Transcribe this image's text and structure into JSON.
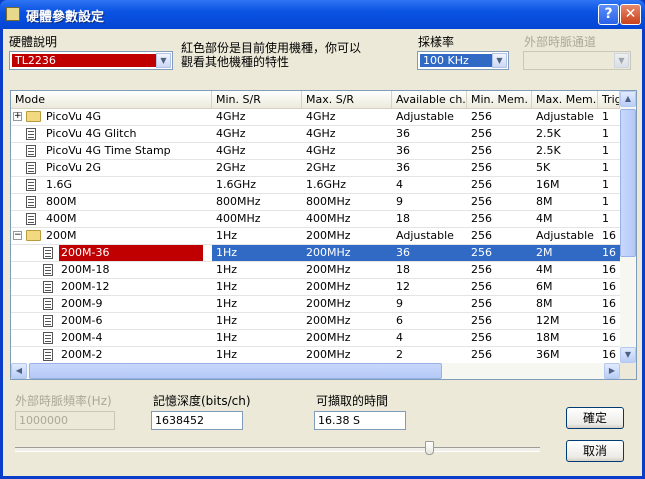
{
  "window": {
    "title": "硬體參數設定",
    "help_label": "?",
    "close_label": "✕"
  },
  "hardware": {
    "label": "硬體說明",
    "value": "TL2236",
    "hint_line1": "紅色部份是目前使用機種，你可以",
    "hint_line2": "觀看其他機種的特性"
  },
  "sample_rate": {
    "label": "採樣率",
    "value": "100 KHz"
  },
  "ext_clock_channel": {
    "label": "外部時脈通道",
    "value": ""
  },
  "table": {
    "columns": [
      "Mode",
      "Min. S/R",
      "Max. S/R",
      "Available ch.",
      "Min. Mem.",
      "Max. Mem.",
      "Trig"
    ],
    "rows": [
      {
        "mode": "PicoVu 4G",
        "min_sr": "4GHz",
        "max_sr": "4GHz",
        "avail": "Adjustable",
        "min_mem": "256",
        "max_mem": "Adjustable",
        "trig": "1"
      },
      {
        "mode": "PicoVu 4G Glitch",
        "min_sr": "4GHz",
        "max_sr": "4GHz",
        "avail": "36",
        "min_mem": "256",
        "max_mem": "2.5K",
        "trig": "1"
      },
      {
        "mode": "PicoVu 4G Time Stamp",
        "min_sr": "4GHz",
        "max_sr": "4GHz",
        "avail": "36",
        "min_mem": "256",
        "max_mem": "2.5K",
        "trig": "1"
      },
      {
        "mode": "PicoVu 2G",
        "min_sr": "2GHz",
        "max_sr": "2GHz",
        "avail": "36",
        "min_mem": "256",
        "max_mem": "5K",
        "trig": "1"
      },
      {
        "mode": "1.6G",
        "min_sr": "1.6GHz",
        "max_sr": "1.6GHz",
        "avail": "4",
        "min_mem": "256",
        "max_mem": "16M",
        "trig": "1"
      },
      {
        "mode": "800M",
        "min_sr": "800MHz",
        "max_sr": "800MHz",
        "avail": "9",
        "min_mem": "256",
        "max_mem": "8M",
        "trig": "1"
      },
      {
        "mode": "400M",
        "min_sr": "400MHz",
        "max_sr": "400MHz",
        "avail": "18",
        "min_mem": "256",
        "max_mem": "4M",
        "trig": "1"
      },
      {
        "mode": "200M",
        "min_sr": "1Hz",
        "max_sr": "200MHz",
        "avail": "Adjustable",
        "min_mem": "256",
        "max_mem": "Adjustable",
        "trig": "16"
      },
      {
        "mode": "200M-36",
        "min_sr": "1Hz",
        "max_sr": "200MHz",
        "avail": "36",
        "min_mem": "256",
        "max_mem": "2M",
        "trig": "16"
      },
      {
        "mode": "200M-18",
        "min_sr": "1Hz",
        "max_sr": "200MHz",
        "avail": "18",
        "min_mem": "256",
        "max_mem": "4M",
        "trig": "16"
      },
      {
        "mode": "200M-12",
        "min_sr": "1Hz",
        "max_sr": "200MHz",
        "avail": "12",
        "min_mem": "256",
        "max_mem": "6M",
        "trig": "16"
      },
      {
        "mode": "200M-9",
        "min_sr": "1Hz",
        "max_sr": "200MHz",
        "avail": "9",
        "min_mem": "256",
        "max_mem": "8M",
        "trig": "16"
      },
      {
        "mode": "200M-6",
        "min_sr": "1Hz",
        "max_sr": "200MHz",
        "avail": "6",
        "min_mem": "256",
        "max_mem": "12M",
        "trig": "16"
      },
      {
        "mode": "200M-4",
        "min_sr": "1Hz",
        "max_sr": "200MHz",
        "avail": "4",
        "min_mem": "256",
        "max_mem": "18M",
        "trig": "16"
      },
      {
        "mode": "200M-2",
        "min_sr": "1Hz",
        "max_sr": "200MHz",
        "avail": "2",
        "min_mem": "256",
        "max_mem": "36M",
        "trig": "16"
      }
    ]
  },
  "ext_clock_freq": {
    "label": "外部時脈頻率(Hz)",
    "value": "1000000"
  },
  "memory_depth": {
    "label": "記憶深度(bits/ch)",
    "value": "1638452"
  },
  "capture_time": {
    "label": "可擷取的時間",
    "value": "16.38 S"
  },
  "buttons": {
    "ok": "確定",
    "cancel": "取消"
  },
  "icons": {
    "help": "help-icon",
    "close": "close-icon",
    "folder": "folder-icon",
    "document": "document-icon",
    "dropdown": "chevron-down-icon"
  },
  "colors": {
    "selection": "#316ac5",
    "current_model": "#c00000",
    "titlebar": "#0a53e3"
  }
}
